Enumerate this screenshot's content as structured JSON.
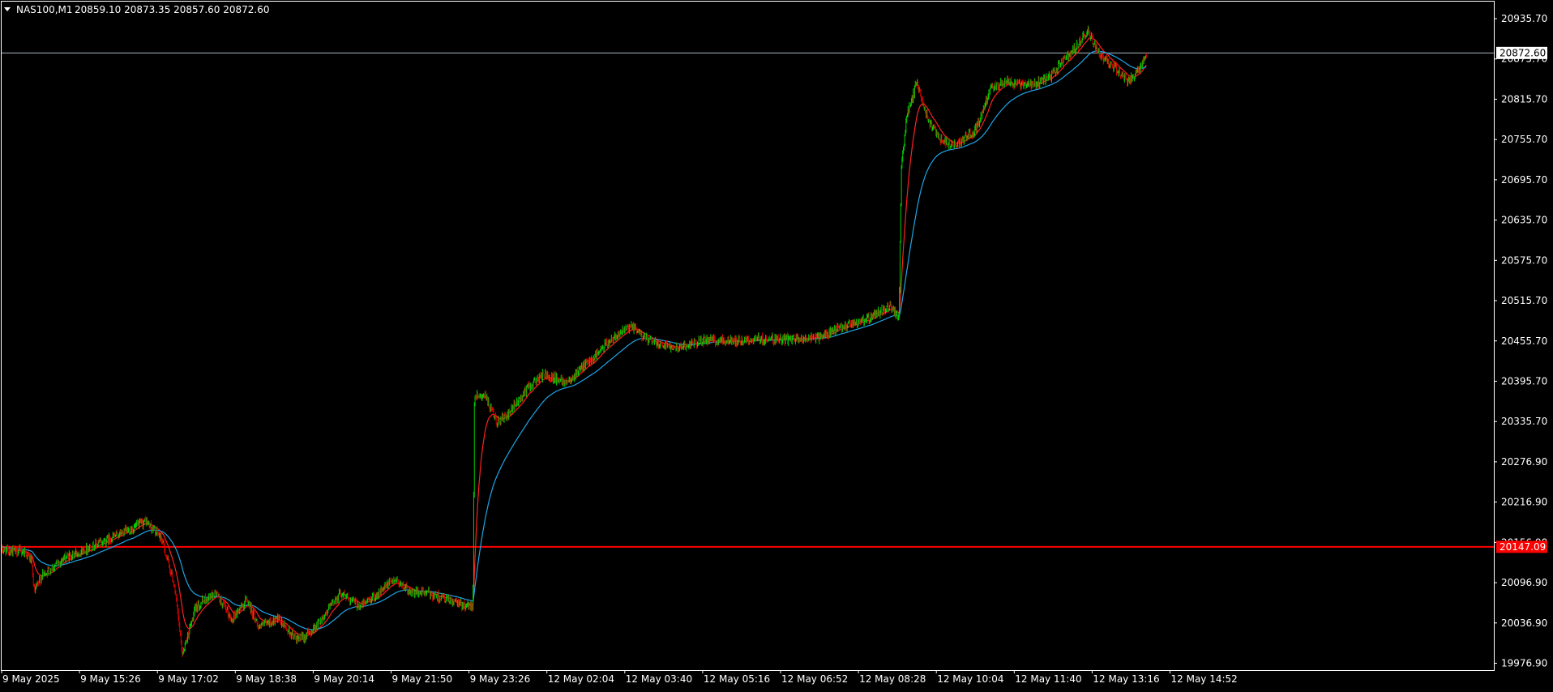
{
  "header": {
    "symbol_timeframe": "NAS100,M1",
    "ohlc": "20859.10 20873.35 20857.60 20872.60"
  },
  "price_tags": {
    "current": "20872.60",
    "level": "20147.09"
  },
  "colors": {
    "background": "#000000",
    "frame": "#ffffff",
    "bull_candle": "#00d000",
    "bear_candle": "#e00000",
    "ma_fast": "#ff2020",
    "ma_slow": "#1fa5e6",
    "level_line": "#ff0000",
    "current_line": "#a8b6c4"
  },
  "icons": {
    "menu": "triangle-down-icon"
  },
  "chart_data": {
    "type": "candlestick",
    "symbol": "NAS100",
    "timeframe": "M1",
    "y_ticks": [
      "20935.70",
      "20875.70",
      "20815.70",
      "20755.70",
      "20695.70",
      "20635.70",
      "20575.70",
      "20515.70",
      "20455.70",
      "20395.70",
      "20335.70",
      "20276.90",
      "20216.90",
      "20156.90",
      "20096.90",
      "20036.90",
      "19976.90"
    ],
    "ylim": [
      19966.0,
      20948.0
    ],
    "x_ticks": [
      "9 May 2025",
      "9 May 15:26",
      "9 May 17:02",
      "9 May 18:38",
      "9 May 20:14",
      "9 May 21:50",
      "9 May 23:26",
      "12 May 02:04",
      "12 May 03:40",
      "12 May 05:16",
      "12 May 06:52",
      "12 May 08:28",
      "12 May 10:04",
      "12 May 11:40",
      "12 May 13:16",
      "12 May 14:52"
    ],
    "current_price": 20872.6,
    "horizontal_level": 20147.09,
    "close_path": [
      {
        "t": 0.0,
        "p": 20142
      },
      {
        "t": 0.3,
        "p": 20140
      },
      {
        "t": 0.38,
        "p": 20127
      },
      {
        "t": 0.42,
        "p": 20080
      },
      {
        "t": 0.52,
        "p": 20105
      },
      {
        "t": 0.8,
        "p": 20130
      },
      {
        "t": 1.2,
        "p": 20150
      },
      {
        "t": 1.7,
        "p": 20175
      },
      {
        "t": 1.85,
        "p": 20185
      },
      {
        "t": 2.05,
        "p": 20160
      },
      {
        "t": 2.22,
        "p": 20090
      },
      {
        "t": 2.32,
        "p": 19990
      },
      {
        "t": 2.5,
        "p": 20060
      },
      {
        "t": 2.75,
        "p": 20080
      },
      {
        "t": 2.95,
        "p": 20040
      },
      {
        "t": 3.15,
        "p": 20070
      },
      {
        "t": 3.3,
        "p": 20030
      },
      {
        "t": 3.55,
        "p": 20040
      },
      {
        "t": 3.8,
        "p": 20010
      },
      {
        "t": 3.95,
        "p": 20020
      },
      {
        "t": 4.1,
        "p": 20040
      },
      {
        "t": 4.35,
        "p": 20080
      },
      {
        "t": 4.6,
        "p": 20060
      },
      {
        "t": 4.85,
        "p": 20080
      },
      {
        "t": 5.05,
        "p": 20100
      },
      {
        "t": 5.25,
        "p": 20080
      },
      {
        "t": 5.45,
        "p": 20080
      },
      {
        "t": 5.7,
        "p": 20070
      },
      {
        "t": 5.95,
        "p": 20060
      },
      {
        "t": 6.05,
        "p": 20062
      },
      {
        "t": 6.07,
        "p": 20370
      },
      {
        "t": 6.2,
        "p": 20370
      },
      {
        "t": 6.35,
        "p": 20330
      },
      {
        "t": 6.5,
        "p": 20340
      },
      {
        "t": 6.75,
        "p": 20380
      },
      {
        "t": 6.95,
        "p": 20400
      },
      {
        "t": 7.25,
        "p": 20390
      },
      {
        "t": 7.55,
        "p": 20420
      },
      {
        "t": 7.9,
        "p": 20460
      },
      {
        "t": 8.1,
        "p": 20470
      },
      {
        "t": 8.3,
        "p": 20450
      },
      {
        "t": 8.7,
        "p": 20440
      },
      {
        "t": 9.0,
        "p": 20450
      },
      {
        "t": 9.4,
        "p": 20450
      },
      {
        "t": 9.8,
        "p": 20452
      },
      {
        "t": 10.2,
        "p": 20452
      },
      {
        "t": 10.5,
        "p": 20455
      },
      {
        "t": 10.8,
        "p": 20470
      },
      {
        "t": 11.1,
        "p": 20480
      },
      {
        "t": 11.4,
        "p": 20500
      },
      {
        "t": 11.52,
        "p": 20485
      },
      {
        "t": 11.55,
        "p": 20700
      },
      {
        "t": 11.62,
        "p": 20780
      },
      {
        "t": 11.75,
        "p": 20830
      },
      {
        "t": 11.9,
        "p": 20770
      },
      {
        "t": 12.1,
        "p": 20740
      },
      {
        "t": 12.3,
        "p": 20740
      },
      {
        "t": 12.5,
        "p": 20760
      },
      {
        "t": 12.7,
        "p": 20820
      },
      {
        "t": 12.9,
        "p": 20830
      },
      {
        "t": 13.2,
        "p": 20825
      },
      {
        "t": 13.45,
        "p": 20835
      },
      {
        "t": 13.6,
        "p": 20860
      },
      {
        "t": 13.75,
        "p": 20875
      },
      {
        "t": 13.95,
        "p": 20905
      },
      {
        "t": 14.1,
        "p": 20870
      },
      {
        "t": 14.3,
        "p": 20850
      },
      {
        "t": 14.45,
        "p": 20830
      },
      {
        "t": 14.6,
        "p": 20845
      },
      {
        "t": 14.7,
        "p": 20872.6
      }
    ]
  }
}
